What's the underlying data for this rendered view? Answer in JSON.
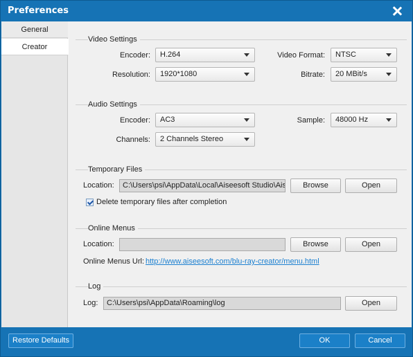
{
  "window": {
    "title": "Preferences"
  },
  "sidebar": {
    "items": [
      {
        "label": "General"
      },
      {
        "label": "Creator"
      }
    ]
  },
  "video": {
    "title": "Video Settings",
    "encoder_label": "Encoder:",
    "encoder_value": "H.264",
    "format_label": "Video Format:",
    "format_value": "NTSC",
    "resolution_label": "Resolution:",
    "resolution_value": "1920*1080",
    "bitrate_label": "Bitrate:",
    "bitrate_value": "20 MBit/s"
  },
  "audio": {
    "title": "Audio Settings",
    "encoder_label": "Encoder:",
    "encoder_value": "AC3",
    "sample_label": "Sample:",
    "sample_value": "48000 Hz",
    "channels_label": "Channels:",
    "channels_value": "2 Channels Stereo"
  },
  "temp": {
    "title": "Temporary Files",
    "location_label": "Location:",
    "location_value": "C:\\Users\\psi\\AppData\\Local\\Aiseesoft Studio\\Aiseesoft",
    "browse_label": "Browse",
    "open_label": "Open",
    "delete_label": "Delete temporary files after completion",
    "delete_checked": true
  },
  "menus": {
    "title": "Online Menus",
    "location_label": "Location:",
    "location_value": "",
    "browse_label": "Browse",
    "open_label": "Open",
    "url_label": "Online Menus Url:",
    "url_value": "http://www.aiseesoft.com/blu-ray-creator/menu.html"
  },
  "log": {
    "title": "Log",
    "log_label": "Log:",
    "log_value": "C:\\Users\\psi\\AppData\\Roaming\\log",
    "open_label": "Open"
  },
  "footer": {
    "restore_label": "Restore Defaults",
    "ok_label": "OK",
    "cancel_label": "Cancel"
  },
  "colors": {
    "accent": "#1673b5",
    "link": "#1a7fd0"
  }
}
